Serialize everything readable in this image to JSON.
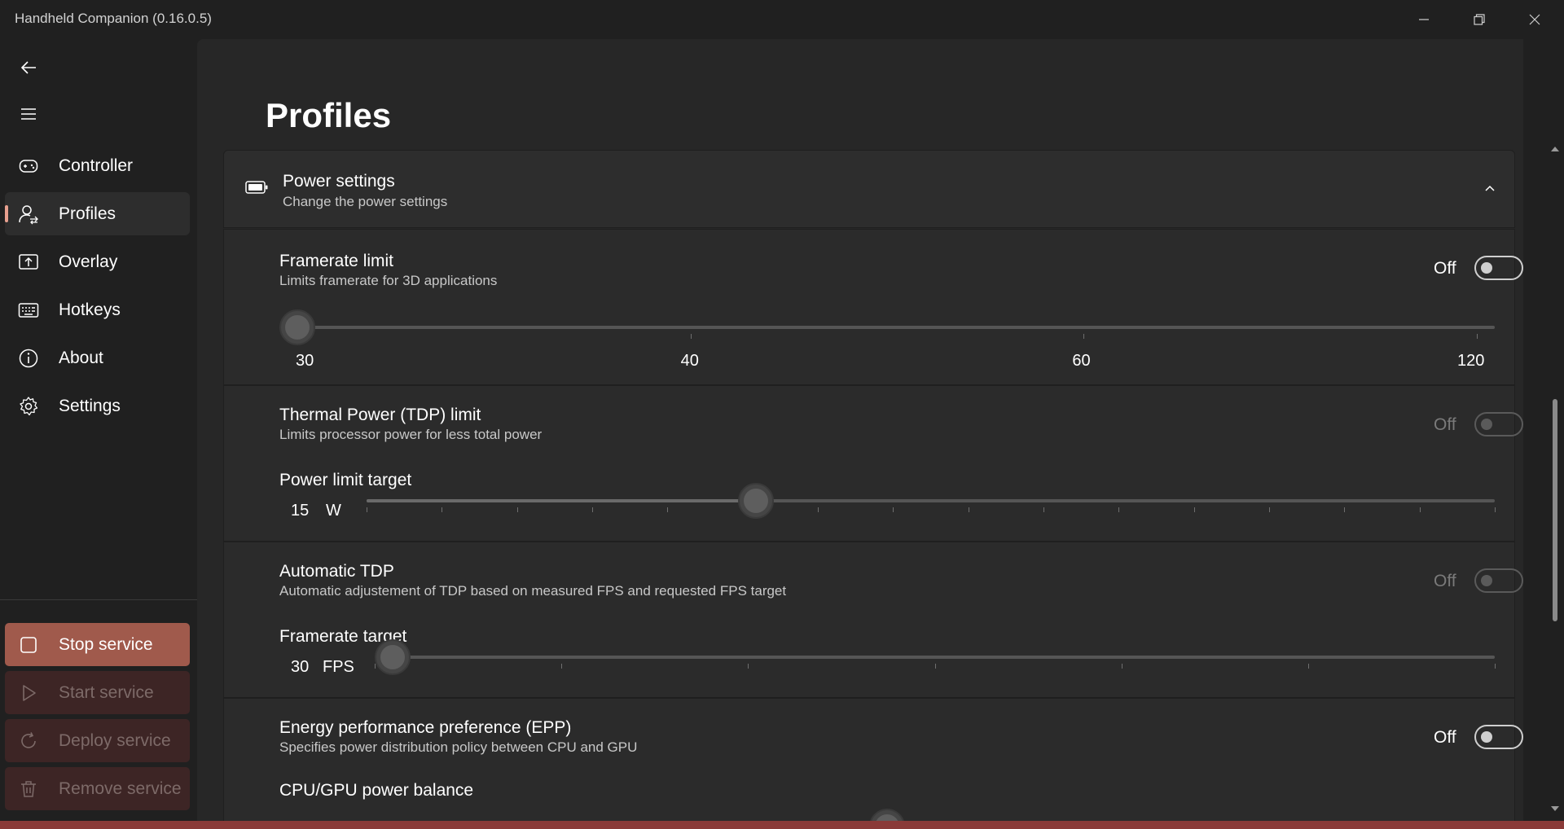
{
  "window": {
    "title": "Handheld Companion (0.16.0.5)"
  },
  "sidebar": {
    "nav_items": [
      {
        "label": "Controller",
        "icon": "gamepad-icon"
      },
      {
        "label": "Profiles",
        "icon": "profiles-icon",
        "selected": true
      },
      {
        "label": "Overlay",
        "icon": "overlay-icon"
      },
      {
        "label": "Hotkeys",
        "icon": "keyboard-icon"
      },
      {
        "label": "About",
        "icon": "info-icon"
      },
      {
        "label": "Settings",
        "icon": "gear-icon"
      }
    ],
    "service_buttons": [
      {
        "label": "Stop service",
        "icon": "stop-icon",
        "enabled": true
      },
      {
        "label": "Start service",
        "icon": "play-icon",
        "enabled": false
      },
      {
        "label": "Deploy service",
        "icon": "refresh-icon",
        "enabled": false
      },
      {
        "label": "Remove service",
        "icon": "trash-icon",
        "enabled": false
      }
    ]
  },
  "main": {
    "page_title": "Profiles",
    "power_settings": {
      "title": "Power settings",
      "subtitle": "Change the power settings"
    },
    "framerate_limit": {
      "title": "Framerate limit",
      "subtitle": "Limits framerate for 3D applications",
      "toggle_state": "Off",
      "tick_labels": [
        "30",
        "40",
        "60",
        "120"
      ],
      "value_index": 0
    },
    "tdp_limit": {
      "title": "Thermal Power (TDP) limit",
      "subtitle": "Limits processor power for less total power",
      "toggle_state": "Off",
      "target_label": "Power limit target",
      "value": "15",
      "unit": "W",
      "fraction": 0.338
    },
    "auto_tdp": {
      "title": "Automatic TDP",
      "subtitle": "Automatic adjustement of TDP based on measured FPS and requested FPS target",
      "toggle_state": "Off",
      "target_label": "Framerate target",
      "value": "30",
      "unit": "FPS",
      "fraction": 0.0
    },
    "epp": {
      "title": "Energy performance preference (EPP)",
      "subtitle": "Specifies power distribution policy between CPU and GPU",
      "toggle_state": "Off",
      "balance_label": "CPU/GPU power balance",
      "fraction": 0.5
    }
  },
  "colors": {
    "accent": "#e8a08f",
    "stop_service_bg": "#a05a4c",
    "disabled_service_bg": "#3d2525"
  }
}
